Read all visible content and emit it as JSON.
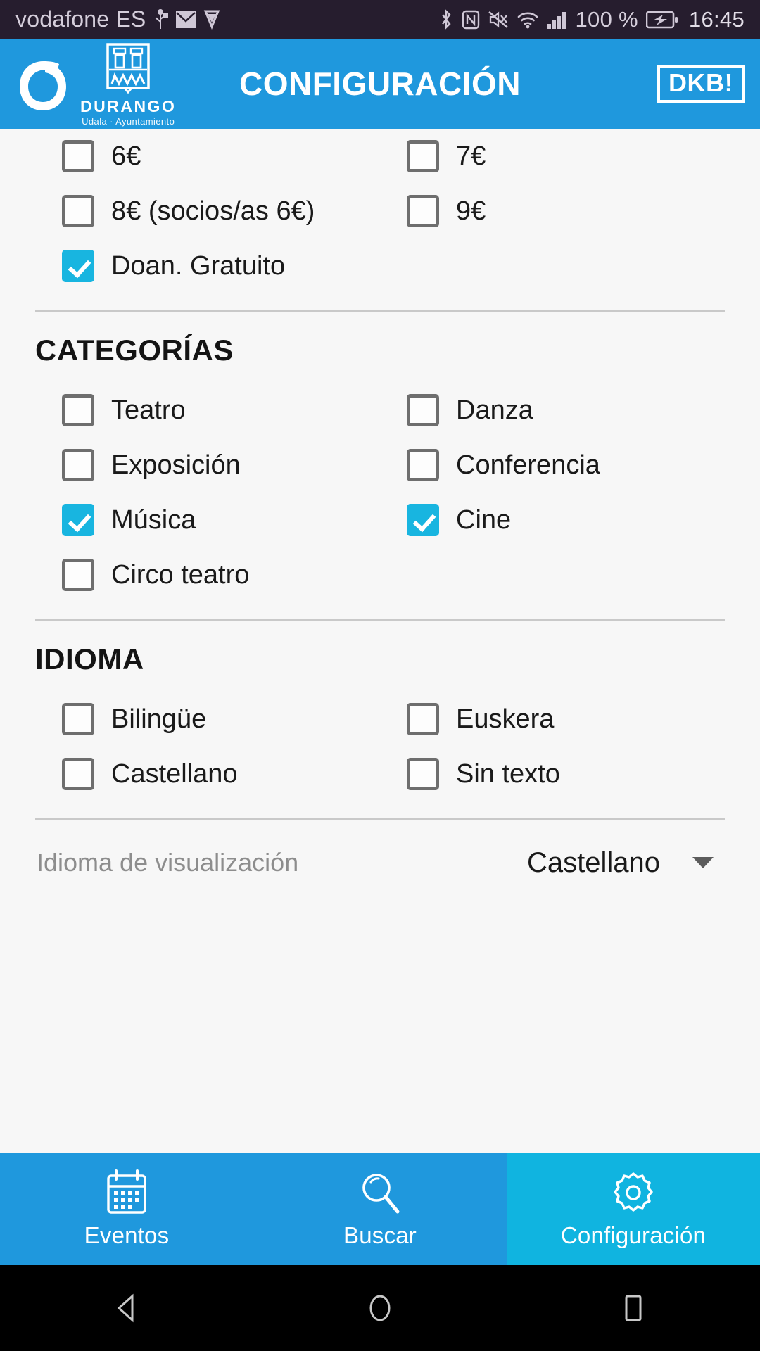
{
  "status_bar": {
    "carrier": "vodafone ES",
    "battery_percent": "100 %",
    "time": "16:45",
    "icons_left": [
      "usb-icon",
      "mail-icon",
      "download-icon"
    ],
    "icons_right": [
      "bluetooth-icon",
      "nfc-icon",
      "mute-icon",
      "wifi-icon",
      "signal-icon",
      "battery-charging-icon"
    ]
  },
  "header": {
    "title": "CONFIGURACIÓN",
    "logo_word": "DURANGO",
    "logo_sub": "Udala · Ayuntamiento",
    "badge": "DKB!",
    "background": "#1f98dd"
  },
  "prices": {
    "items": [
      {
        "label": "6€",
        "checked": false
      },
      {
        "label": "7€",
        "checked": false
      },
      {
        "label": "8€ (socios/as 6€)",
        "checked": false
      },
      {
        "label": "9€",
        "checked": false
      },
      {
        "label": "Doan. Gratuito",
        "checked": true
      }
    ]
  },
  "categories": {
    "title": "CATEGORÍAS",
    "items": [
      {
        "label": "Teatro",
        "checked": false
      },
      {
        "label": "Danza",
        "checked": false
      },
      {
        "label": "Exposición",
        "checked": false
      },
      {
        "label": "Conferencia",
        "checked": false
      },
      {
        "label": "Música",
        "checked": true
      },
      {
        "label": "Cine",
        "checked": true
      },
      {
        "label": "Circo teatro",
        "checked": false
      }
    ]
  },
  "language": {
    "title": "IDIOMA",
    "items": [
      {
        "label": "Bilingüe",
        "checked": false
      },
      {
        "label": "Euskera",
        "checked": false
      },
      {
        "label": "Castellano",
        "checked": false
      },
      {
        "label": "Sin texto",
        "checked": false
      }
    ],
    "display_label": "Idioma de visualización",
    "display_value": "Castellano"
  },
  "tabs": [
    {
      "label": "Eventos",
      "icon": "calendar-icon",
      "active": false
    },
    {
      "label": "Buscar",
      "icon": "search-icon",
      "active": false
    },
    {
      "label": "Configuración",
      "icon": "gear-icon",
      "active": true
    }
  ],
  "android_nav": [
    "back-icon",
    "home-icon",
    "recents-icon"
  ],
  "colors": {
    "accent": "#18b5e0",
    "header_blue": "#1f98dd",
    "active_tab": "#10b4e0",
    "status_bar": "#261d2e"
  }
}
